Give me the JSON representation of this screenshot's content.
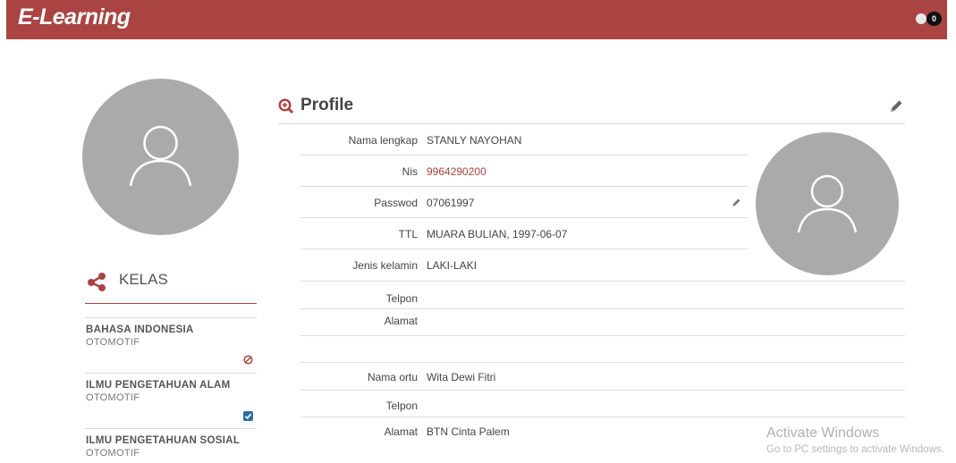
{
  "header": {
    "brand": "E-Learning",
    "notification_count": "0",
    "icons": [
      "globe-icon",
      "notification-badge"
    ]
  },
  "colors": {
    "brand": "#a94442",
    "avatar_bg": "#aaaaaa"
  },
  "sidebar": {
    "section_title": "KELAS",
    "section_icon": "share-icon",
    "classes": [
      {
        "name": "BAHASA INDONESIA",
        "sub": "OTOMOTIF",
        "status_icon": "ban-icon"
      },
      {
        "name": "ILMU PENGETAHUAN ALAM",
        "sub": "OTOMOTIF",
        "status_icon": "checkbox-checked-icon"
      },
      {
        "name": "ILMU PENGETAHUAN SOSIAL",
        "sub": "OTOMOTIF",
        "status_icon": ""
      }
    ]
  },
  "profile": {
    "title": "Profile",
    "title_icon": "zoom-in-icon",
    "edit_icon": "pencil-icon",
    "rows": [
      {
        "label": "Nama lengkap",
        "value": "STANLY NAYOHAN"
      },
      {
        "label": "Nis",
        "value": "9964290200"
      },
      {
        "label": "Passwod",
        "value": "07061997"
      },
      {
        "label": "TTL",
        "value": "MUARA BULIAN, 1997-06-07"
      },
      {
        "label": "Jenis kelamin",
        "value": "LAKI-LAKI"
      },
      {
        "label": "Telpon",
        "value": ""
      },
      {
        "label": "Alamat",
        "value": ""
      },
      {
        "label": "",
        "value": ""
      },
      {
        "label": "Nama ortu",
        "value": "Wita Dewi Fitri"
      },
      {
        "label": "Telpon",
        "value": ""
      },
      {
        "label": "Alamat",
        "value": "BTN Cinta Palem"
      }
    ]
  },
  "watermark": {
    "line1": "Activate Windows",
    "line2": "Go to PC settings to activate Windows."
  }
}
